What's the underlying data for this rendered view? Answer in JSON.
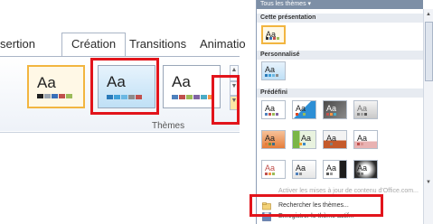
{
  "ribbon": {
    "tabs": [
      "sertion",
      "Création",
      "Transitions",
      "Animatio"
    ],
    "active_tab": "Création",
    "group_label": "Thèmes",
    "theme_sample_text": "Aa"
  },
  "panel": {
    "header": "Tous les thèmes ▾",
    "sections": {
      "current": "Cette présentation",
      "custom": "Personnalisé",
      "builtin": "Prédéfini"
    },
    "sample_text": "Aa",
    "menu": {
      "disabled_item": "Activer les mises à jour de contenu d'Office.com...",
      "browse": "Rechercher les thèmes...",
      "save": "Enregistrer le thème actif..."
    }
  },
  "colors": {
    "highlight": "#e2141b",
    "selected_theme_border": "#f2b540"
  }
}
